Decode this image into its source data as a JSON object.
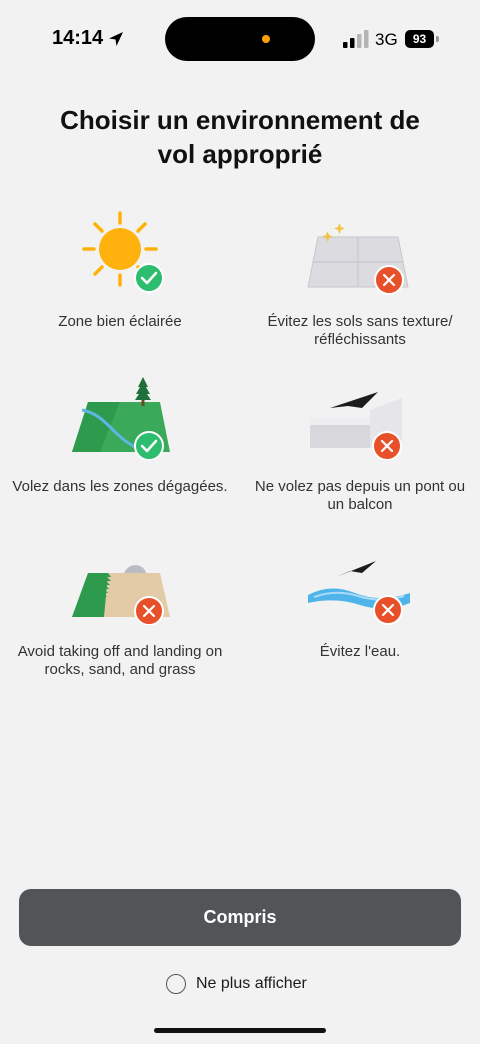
{
  "status_bar": {
    "time": "14:14",
    "network": "3G",
    "battery": "93"
  },
  "title": "Choisir un environnement de vol approprié",
  "tips": [
    {
      "caption": "Zone bien éclairée",
      "status": "ok",
      "icon": "sun-icon"
    },
    {
      "caption": "Évitez les sols sans texture/ réfléchissants",
      "status": "bad",
      "icon": "reflective-floor-icon"
    },
    {
      "caption": "Volez dans les zones dégagées.",
      "status": "ok",
      "icon": "open-field-icon"
    },
    {
      "caption": "Ne volez pas depuis un pont ou un balcon",
      "status": "bad",
      "icon": "bridge-balcony-icon"
    },
    {
      "caption": "Avoid taking off and landing on rocks, sand, and grass",
      "status": "bad",
      "icon": "rocks-sand-grass-icon"
    },
    {
      "caption": "Évitez l'eau.",
      "status": "bad",
      "icon": "water-icon"
    }
  ],
  "colors": {
    "ok": "#2dbd6e",
    "bad": "#e8502a",
    "button": "#525557",
    "sun": "#ffb20d"
  },
  "buttons": {
    "confirm_label": "Compris"
  },
  "dont_show_label": "Ne plus afficher"
}
